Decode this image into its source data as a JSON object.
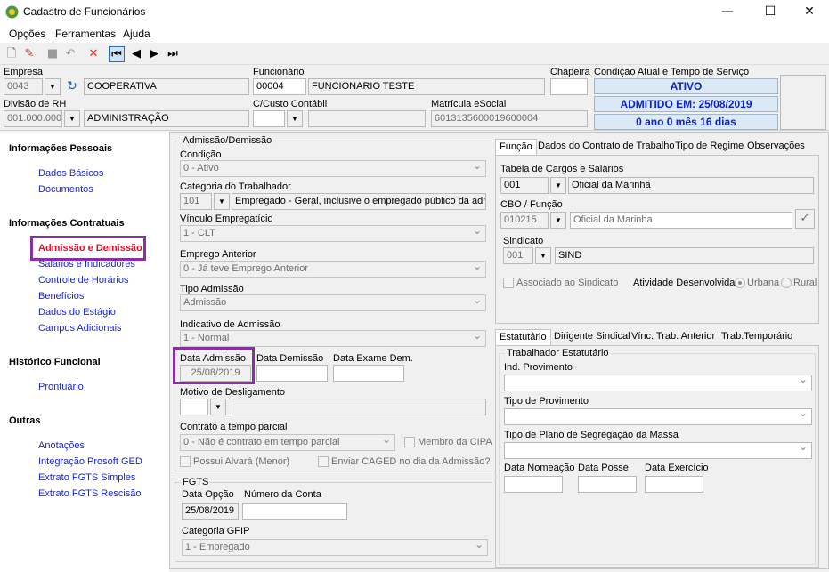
{
  "window": {
    "title": "Cadastro de Funcionários",
    "minimize": "—",
    "maximize": "☐",
    "close": "✕"
  },
  "menu": [
    "Opções",
    "Ferramentas",
    "Ajuda"
  ],
  "header": {
    "empresa_label": "Empresa",
    "empresa_code": "0043",
    "empresa_name": "COOPERATIVA",
    "funcionario_label": "Funcionário",
    "funcionario_code": "00004",
    "funcionario_name": "FUNCIONARIO TESTE",
    "chapeira_label": "Chapeira",
    "chapeira_value": "",
    "condicao_label": "Condição Atual e Tempo de Serviço",
    "status": [
      "ATIVO",
      "ADMITIDO EM: 25/08/2019",
      "0 ano 0 mês 16 dias"
    ],
    "divisao_label": "Divisão de RH",
    "divisao_code": "001.000.000",
    "divisao_name": "ADMINISTRAÇÃO",
    "custo_label": "C/Custo Contábil",
    "custo_code": "",
    "custo_name": "",
    "matricula_label": "Matrícula eSocial",
    "matricula_value": "6013135600019600004"
  },
  "sidebar": {
    "sections": [
      {
        "title": "Informações Pessoais",
        "items": [
          "Dados Básicos",
          "Documentos"
        ]
      },
      {
        "title": "Informações Contratuais",
        "items": [
          "Admissão e Demissão",
          "Salários e Indicadores",
          "Controle de Horários",
          "Benefícios",
          "Dados do Estágio",
          "Campos Adicionais"
        ]
      },
      {
        "title": "Histórico Funcional",
        "items": [
          "Prontuário"
        ]
      },
      {
        "title": "Outras",
        "items": [
          "Anotações",
          "Integração Prosoft GED",
          "Extrato FGTS Simples",
          "Extrato FGTS Rescisão"
        ]
      }
    ]
  },
  "admissao": {
    "group_title": "Admissão/Demissão",
    "condicao_label": "Condição",
    "condicao_value": "0 - Ativo",
    "categoria_label": "Categoria do Trabalhador",
    "categoria_code": "101",
    "categoria_desc": "Empregado - Geral, inclusive o empregado público da administ",
    "vinculo_label": "Vínculo Empregatício",
    "vinculo_value": "1 - CLT",
    "emprego_label": "Emprego Anterior",
    "emprego_value": "0 - Já teve Emprego Anterior",
    "tipo_label": "Tipo Admissão",
    "tipo_value": "Admissão",
    "indicativo_label": "Indicativo de Admissão",
    "indicativo_value": "1 - Normal",
    "data_adm_label": "Data Admissão",
    "data_adm_value": "25/08/2019",
    "data_dem_label": "Data Demissão",
    "data_dem_value": "",
    "data_exame_label": "Data Exame Dem.",
    "data_exame_value": "",
    "motivo_label": "Motivo de Desligamento",
    "contrato_label": "Contrato a tempo parcial",
    "contrato_value": "0 - Não é contrato em tempo parcial",
    "membro_cipa": "Membro da CIPA",
    "possui_alvara": "Possui Alvará (Menor)",
    "enviar_caged": "Enviar CAGED no dia da Admissão?"
  },
  "fgts": {
    "group_title": "FGTS",
    "data_opcao_label": "Data Opção",
    "data_opcao_value": "25/08/2019",
    "numero_conta_label": "Número da Conta",
    "numero_conta_value": "",
    "categoria_label": "Categoria GFIP",
    "categoria_value": "1 - Empregado"
  },
  "tabs_top": [
    "Função",
    "Dados do Contrato de Trabalho",
    "Tipo de Regime",
    "Observações"
  ],
  "funcao": {
    "tabela_label": "Tabela de Cargos e Salários",
    "tabela_code": "001",
    "tabela_name": "Oficial da Marinha",
    "cbo_label": "CBO / Função",
    "cbo_code": "010215",
    "cbo_name": "Oficial da Marinha",
    "sindicato_label": "Sindicato",
    "sindicato_code": "001",
    "sindicato_name": "SIND",
    "associado": "Associado ao Sindicato",
    "atividade_label": "Atividade Desenvolvida:",
    "urbana": "Urbana",
    "rural": "Rural"
  },
  "tabs_bottom": [
    "Estatutário",
    "Dirigente Sindical",
    "Vínc. Trab. Anterior",
    "Trab.Temporário"
  ],
  "estatutario": {
    "group_title": "Trabalhador Estatutário",
    "ind_label": "Ind. Provimento",
    "tipo_label": "Tipo de Provimento",
    "plano_label": "Tipo de Plano de Segregação da Massa",
    "nomeacao_label": "Data Nomeação",
    "posse_label": "Data Posse",
    "exercicio_label": "Data Exercício"
  },
  "colors": {
    "accent": "#1b27c9",
    "highlight": "#8a2fa3",
    "active_item": "#e0102f"
  }
}
